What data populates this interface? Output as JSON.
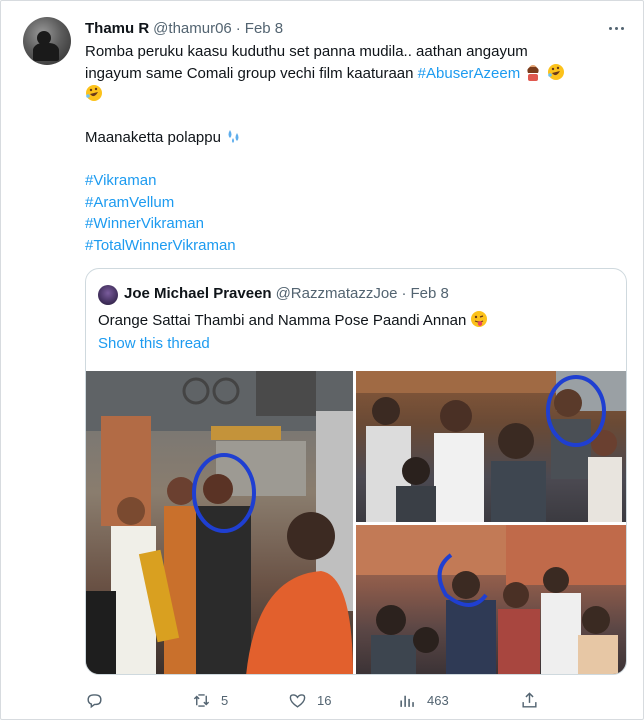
{
  "tweet": {
    "author_name": "Thamu R",
    "handle": "@thamur06",
    "separator": "·",
    "date": "Feb 8",
    "line1": "Romba peruku kaasu kuduthu set panna mudila.. aathan angayum",
    "line2_text": "ingayum same Comali group vechi film kaaturaan ",
    "line2_hashtag": "#AbuserAzeem",
    "line4": "Maanaketta polappu",
    "hashtags": [
      "#Vikraman",
      "#AramVellum",
      "#WinnerVikraman",
      "#TotalWinnerVikraman"
    ]
  },
  "quote": {
    "author_name": "Joe Michael Praveen",
    "handle": "@RazzmatazzJoe",
    "separator": "·",
    "date": "Feb 8",
    "text": "Orange Sattai Thambi and Namma Pose Paandi Annan",
    "show_thread": "Show this thread"
  },
  "actions": {
    "replies": "",
    "retweets": "5",
    "likes": "16",
    "views": "463"
  },
  "icons": {
    "more": "more-icon",
    "reply": "reply-icon",
    "retweet": "retweet-icon",
    "like": "heart-icon",
    "views": "views-icon",
    "share": "share-icon"
  },
  "colors": {
    "link": "#1d9bf0",
    "secondary_text": "#536471",
    "annotation_circle": "#1f3fd1"
  }
}
